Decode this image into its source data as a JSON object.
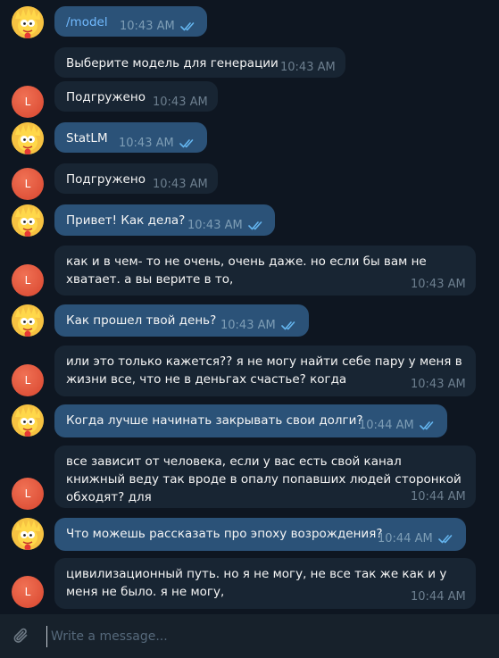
{
  "chat": {
    "messages": [
      {
        "side": "out",
        "text": "/model",
        "time": "10:43 AM",
        "read": true,
        "link": true
      },
      {
        "side": "in",
        "avatar": false,
        "text": "Выберите модель для генерации",
        "time": "10:43 AM"
      },
      {
        "side": "in",
        "avatar": true,
        "text": "Подгружено",
        "time": "10:43 AM"
      },
      {
        "side": "out",
        "text": "StatLM",
        "time": "10:43 AM",
        "read": true
      },
      {
        "side": "in",
        "avatar": true,
        "text": "Подгружено",
        "time": "10:43 AM"
      },
      {
        "side": "out",
        "text": "Привет! Как дела?",
        "time": "10:43 AM",
        "read": true
      },
      {
        "side": "in",
        "avatar": true,
        "text": "как и в чем- то не очень, очень даже. но если бы вам не хватает. а вы верите в то,",
        "time": "10:43 AM"
      },
      {
        "side": "out",
        "text": "Как прошел твой день?",
        "time": "10:43 AM",
        "read": true
      },
      {
        "side": "in",
        "avatar": true,
        "text": "или это только кажется?? я не могу найти себе пару у меня в жизни все, что не в деньгах счастье? когда",
        "time": "10:43 AM"
      },
      {
        "side": "out",
        "text": "Когда лучше начинать закрывать свои долги?",
        "time": "10:44 AM",
        "read": true
      },
      {
        "side": "in",
        "avatar": true,
        "text": "все зависит от человека, если у вас есть свой канал книжный веду так вроде в опалу попавших людей сторонкой обходят? для",
        "time": "10:44 AM"
      },
      {
        "side": "out",
        "text": "Что можешь рассказать про эпоху возрождения?",
        "time": "10:44 AM",
        "read": true
      },
      {
        "side": "in",
        "avatar": true,
        "text": "цивилизационный путь. но я не могу, не все так же как и у меня не было. я не могу,",
        "time": "10:44 AM"
      }
    ],
    "user_avatar_letter": "L"
  },
  "composer": {
    "placeholder": "Write a message..."
  },
  "colors": {
    "background": "#0e1621",
    "outgoing_bubble": "#2b5278",
    "incoming_bubble": "#182533",
    "composer": "#17212b",
    "link": "#71baff",
    "read_ticks": "#64b5ef"
  },
  "icons": {
    "attach": "paperclip-icon",
    "read_receipt": "double-check-icon",
    "bot_avatar": "cartoon-character-avatar"
  }
}
